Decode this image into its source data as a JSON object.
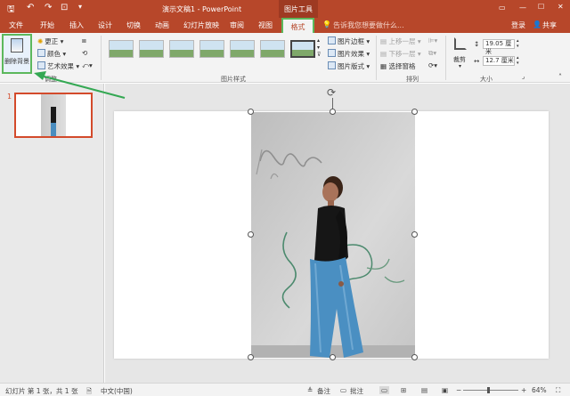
{
  "window": {
    "title": "演示文稿1 - PowerPoint",
    "context_tab_group": "图片工具",
    "tell_me": "告诉我您想要做什么...",
    "login": "登录",
    "share": "共享"
  },
  "tabs": [
    "文件",
    "开始",
    "插入",
    "设计",
    "切换",
    "动画",
    "幻灯片放映",
    "审阅",
    "视图",
    "格式"
  ],
  "ribbon": {
    "adjust": {
      "remove_bg": "删除背景",
      "corrections": "更正",
      "color": "颜色",
      "artistic": "艺术效果",
      "group_label": "调整"
    },
    "styles": {
      "border": "图片边框",
      "effects": "图片效果",
      "layout": "图片版式",
      "group_label": "图片样式"
    },
    "arrange": {
      "bring_forward": "上移一层",
      "send_backward": "下移一层",
      "selection_pane": "选择窗格",
      "group_label": "排列"
    },
    "size": {
      "crop": "裁剪",
      "height": "19.05 厘米",
      "width": "12.7 厘米",
      "group_label": "大小"
    }
  },
  "slides": {
    "number": "1"
  },
  "status": {
    "slide_info": "幻灯片 第 1 张，共 1 张",
    "language": "中文(中国)",
    "notes": "备注",
    "comments": "批注",
    "zoom": "64%"
  },
  "colors": {
    "accent": "#b7472a",
    "annotation_green": "#34a853"
  }
}
